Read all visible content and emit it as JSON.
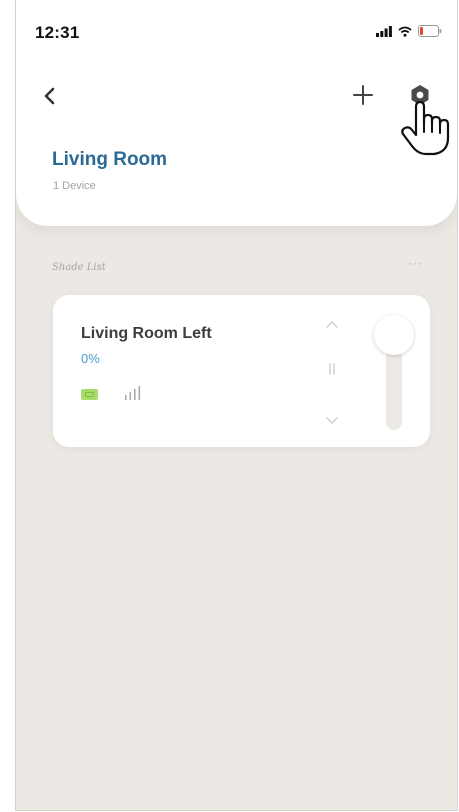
{
  "status_bar": {
    "time": "12:31"
  },
  "header": {
    "room_title": "Living Room",
    "device_count": "1 Device"
  },
  "shade_list": {
    "label": "Shade List",
    "more": "···",
    "items": [
      {
        "name": "Living Room Left",
        "position_percent": "0%",
        "position_fraction": 0
      }
    ]
  },
  "icons": {
    "back": "chevron-left-icon",
    "add": "plus-icon",
    "settings": "gear-icon",
    "cursor": "hand-pointer-icon",
    "battery": "battery-icon",
    "signal": "signal-icon",
    "up": "chevron-up-icon",
    "pause": "pause-icon",
    "down": "chevron-down-icon"
  },
  "colors": {
    "accent": "#2b6a97",
    "percent": "#4a9bc6",
    "battery": "#a8dc6a",
    "background": "#ece8e3"
  }
}
